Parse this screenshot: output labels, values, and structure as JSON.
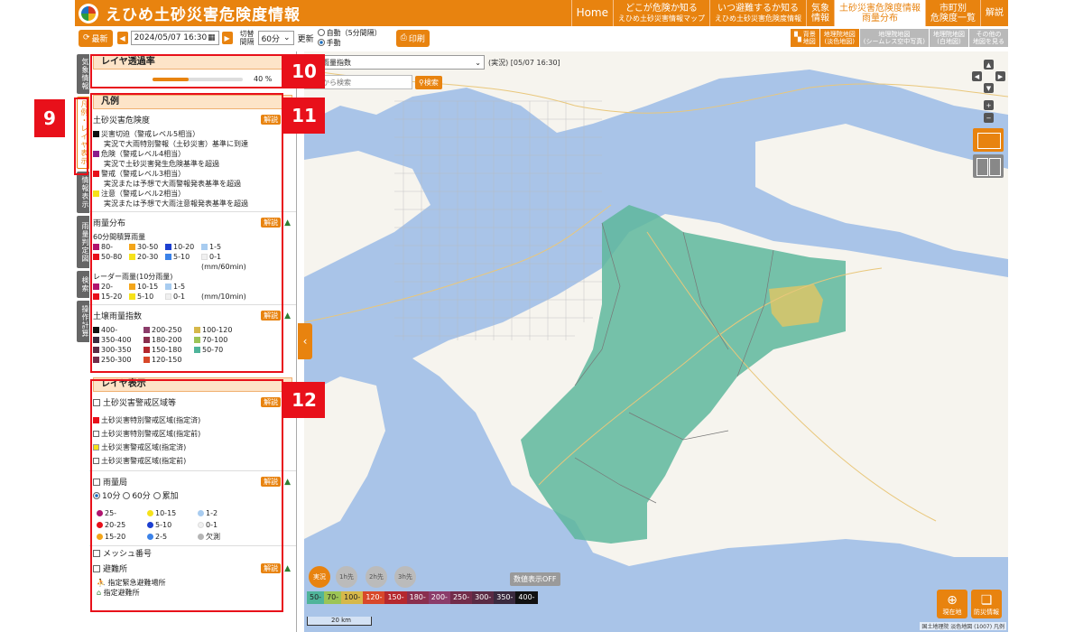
{
  "header": {
    "site_title": "えひめ土砂災害危険度情報",
    "nav": [
      {
        "label": "Home"
      },
      {
        "label": "どこが危険か知る",
        "sub": "えひめ土砂災害情報マップ"
      },
      {
        "label": "いつ避難するか知る",
        "sub": "えひめ土砂災害危険度情報"
      },
      {
        "label": "気象",
        "sub": "情報"
      },
      {
        "label": "土砂災害危険度情報",
        "sub": "雨量分布"
      },
      {
        "label": "市町別",
        "sub": "危険度一覧"
      },
      {
        "label": "解説"
      }
    ]
  },
  "toolbar": {
    "refresh_label": "最新",
    "prev_label": "◀",
    "date_value": "2024/05/07 16:30",
    "next_label": "▶",
    "interval_label_1": "切替",
    "interval_label_2": "間隔",
    "interval_value": "60分",
    "update_label": "更新",
    "auto_label": "自動（5分間隔）",
    "manual_label": "手動",
    "print_label": "印刷",
    "basemaps": [
      {
        "label1": "背景",
        "label2": "地図"
      },
      {
        "label1": "地理院地図",
        "label2": "(淡色地図)"
      },
      {
        "label1": "地理院地図",
        "label2": "(シームレス空中写真)"
      },
      {
        "label1": "地理院地図",
        "label2": "(白地図)"
      },
      {
        "label1": "その他の",
        "label2": "地図を見る"
      }
    ]
  },
  "side_tabs": [
    "気象情報",
    "凡例・レイヤ表示",
    "情報表示",
    "雨量判定図",
    "検索",
    "操作計算"
  ],
  "transparency": {
    "title": "レイヤ透過率",
    "value": "40 %",
    "level": 0.4
  },
  "legend": {
    "title": "凡例",
    "explain_label": "解説",
    "danger": {
      "title": "土砂災害危険度",
      "items": [
        {
          "color": "#111111",
          "line1": "災害切迫（警戒レベル5相当）",
          "line2": "実況で大雨特別警報（土砂災害）基準に到達"
        },
        {
          "color": "#8b1c8b",
          "line1": "危険（警戒レベル4相当）",
          "line2": "実況で土砂災害発生危険基準を超過"
        },
        {
          "color": "#e8101a",
          "line1": "警戒（警戒レベル3相当）",
          "line2": "実況または予想で大雨警報発表基準を超過"
        },
        {
          "color": "#f6e21a",
          "line1": "注意（警戒レベル2相当）",
          "line2": "実況または予想で大雨注意報発表基準を超過"
        }
      ]
    },
    "rain": {
      "title": "雨量分布",
      "sub1": "60分間積算雨量",
      "acc": [
        {
          "color": "#b0146e",
          "label": "80-"
        },
        {
          "color": "#f3a51a",
          "label": "30-50"
        },
        {
          "color": "#1c3fd0",
          "label": "10-20"
        },
        {
          "color": "#a8ccf0",
          "label": "1-5"
        },
        {
          "color": "#e8101a",
          "label": "50-80"
        },
        {
          "color": "#f6e21a",
          "label": "20-30"
        },
        {
          "color": "#3b82e8",
          "label": "5-10"
        },
        {
          "color": "#f0f0f0",
          "label": "0-1"
        }
      ],
      "acc_unit": "(mm/60min)",
      "sub2": "レーダー雨量(10分雨量)",
      "radar": [
        {
          "color": "#b0146e",
          "label": "20-"
        },
        {
          "color": "#f3a51a",
          "label": "10-15"
        },
        {
          "color": "#a8ccf0",
          "label": "1-5"
        },
        {
          "color": "#e8101a",
          "label": "15-20"
        },
        {
          "color": "#f6e21a",
          "label": "5-10"
        },
        {
          "color": "#f0f0f0",
          "label": "0-1"
        }
      ],
      "radar_unit": "(mm/10min)"
    },
    "soil": {
      "title": "土壌雨量指数",
      "items": [
        {
          "color": "#111111",
          "label": "400-"
        },
        {
          "color": "#8b3c6a",
          "label": "200-250"
        },
        {
          "color": "#d6b84a",
          "label": "100-120"
        },
        {
          "color": "#3a2a3e",
          "label": "350-400"
        },
        {
          "color": "#8a2f4e",
          "label": "180-200"
        },
        {
          "color": "#9cc456",
          "label": "70-100"
        },
        {
          "color": "#5a2b44",
          "label": "300-350"
        },
        {
          "color": "#b5282e",
          "label": "150-180"
        },
        {
          "color": "#4fb49a",
          "label": "50-70"
        },
        {
          "color": "#722c4a",
          "label": "250-300"
        },
        {
          "color": "#d8482a",
          "label": "120-150"
        }
      ]
    }
  },
  "layers": {
    "title": "レイヤ表示",
    "explain_label": "解説",
    "zones": {
      "title": "土砂災害警戒区域等",
      "items": [
        {
          "color": "#e8101a",
          "label": "土砂災害特別警戒区域(指定済)"
        },
        {
          "color": "#ffffff",
          "label": "土砂災害特別警戒区域(指定前)"
        },
        {
          "color": "#f6e21a",
          "label": "土砂災害警戒区域(指定済)"
        },
        {
          "color": "#ffffff",
          "label": "土砂災害警戒区域(指定前)"
        }
      ]
    },
    "stations": {
      "title": "雨量局",
      "opt1": "10分",
      "opt2": "60分",
      "opt3": "累加",
      "items": [
        {
          "color": "#b0146e",
          "label": "25-"
        },
        {
          "color": "#f6e21a",
          "label": "10-15"
        },
        {
          "color": "#a8ccf0",
          "label": "1-2"
        },
        {
          "color": "#e8101a",
          "label": "20-25"
        },
        {
          "color": "#1c3fd0",
          "label": "5-10"
        },
        {
          "color": "#f0f0f0",
          "label": "0-1"
        },
        {
          "color": "#f3a51a",
          "label": "15-20"
        },
        {
          "color": "#3b82e8",
          "label": "2-5"
        },
        {
          "color": "#b5b5b5",
          "label": "欠測"
        }
      ]
    },
    "mesh_label": "メッシュ番号",
    "shelter": {
      "title": "避難所",
      "item1": "指定緊急避難場所",
      "item2": "指定避難所"
    }
  },
  "callouts": [
    "9",
    "10",
    "11",
    "12"
  ],
  "map": {
    "layer_select": "土壌雨量指数",
    "status": "(実況) [05/07 16:30]",
    "search_placeholder": "住所から検索",
    "search_button": "検索",
    "time_buttons": [
      "実況",
      "1h先",
      "2h先",
      "3h先"
    ],
    "num_display": "数値表示OFF",
    "color_bar": [
      {
        "label": "50-",
        "color": "#4fb49a"
      },
      {
        "label": "70-",
        "color": "#9cc456"
      },
      {
        "label": "100-",
        "color": "#d6b84a"
      },
      {
        "label": "120-",
        "color": "#d8482a"
      },
      {
        "label": "150-",
        "color": "#b5282e"
      },
      {
        "label": "180-",
        "color": "#8a2f4e"
      },
      {
        "label": "200-",
        "color": "#8b3c6a"
      },
      {
        "label": "250-",
        "color": "#722c4a"
      },
      {
        "label": "300-",
        "color": "#5a2b44"
      },
      {
        "label": "350-",
        "color": "#3a2a3e"
      },
      {
        "label": "400-",
        "color": "#111111"
      }
    ],
    "scale": "20 km",
    "location_button": "現在地",
    "disaster_button": "防災情報",
    "attribution": "国土地理院 淡色地図 (1007) 凡例"
  }
}
